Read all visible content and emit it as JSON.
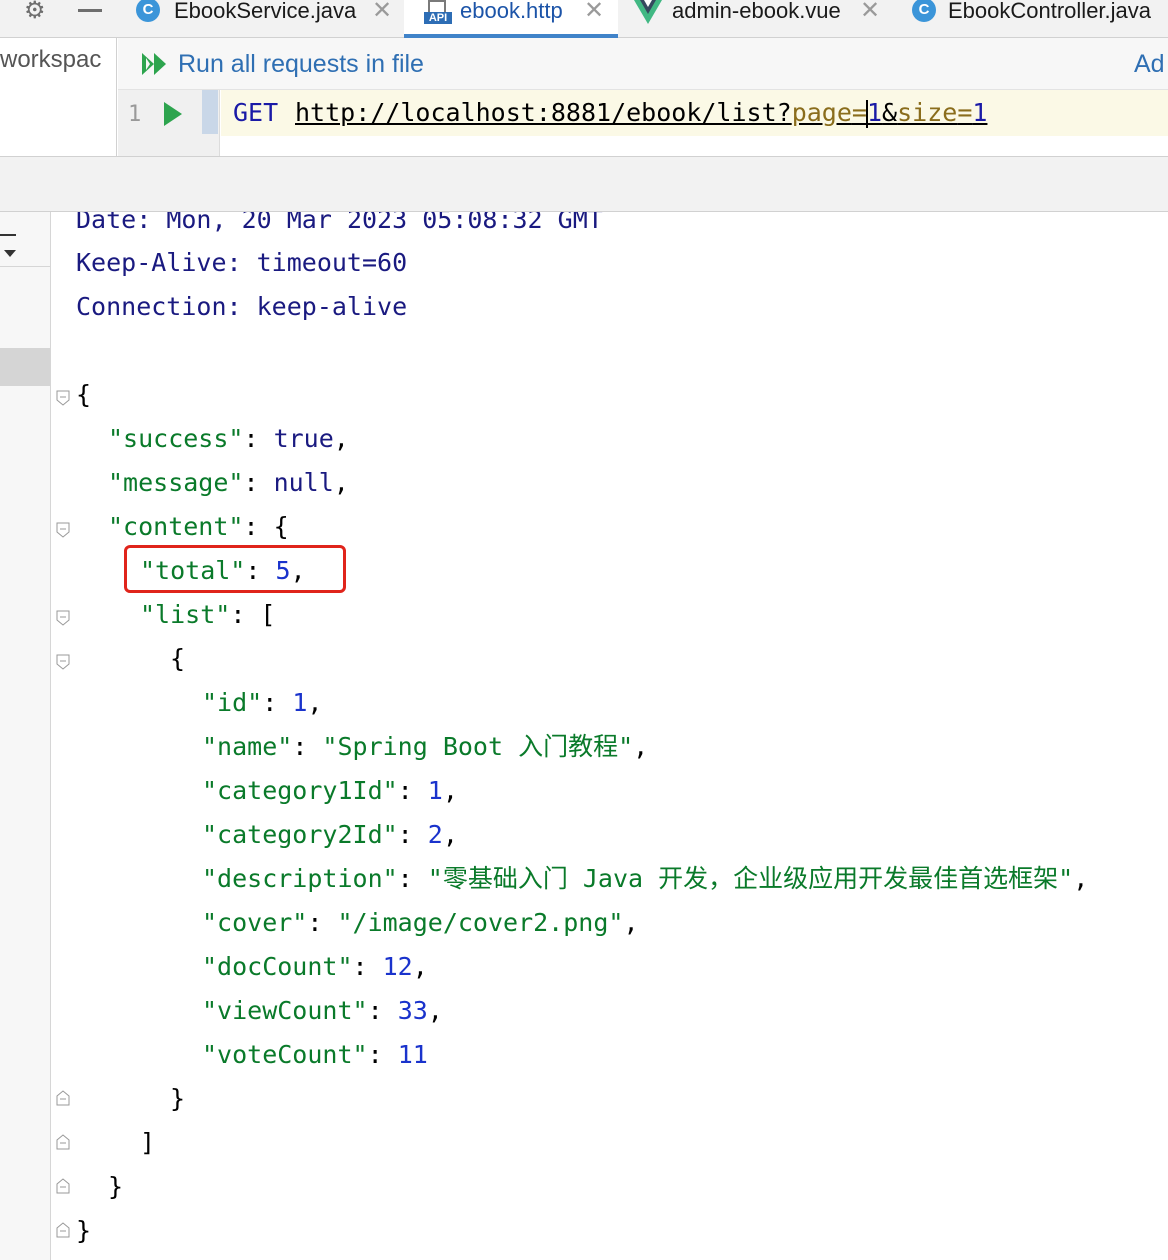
{
  "tabs": [
    {
      "label": "EbookService.java",
      "icon": "java-class-icon",
      "closable": true
    },
    {
      "label": "ebook.http",
      "icon": "api-file-icon",
      "closable": true,
      "active": true
    },
    {
      "label": "admin-ebook.vue",
      "icon": "vue-icon",
      "closable": true
    },
    {
      "label": "EbookController.java",
      "icon": "java-class-icon"
    }
  ],
  "sidebar": {
    "workspace_label": "workspac"
  },
  "runbar": {
    "run_all_label": "Run all requests in file",
    "add_label": "Ad"
  },
  "request": {
    "line_number": "1",
    "method": "GET",
    "url_base": "http://localhost:8881/ebook/list?",
    "param1_name": "page",
    "eq1": "=",
    "param1_value": "1",
    "amp": "&",
    "param2_name": "size",
    "eq2": "=",
    "param2_value": "1"
  },
  "response": {
    "headers": [
      {
        "name": "Date",
        "value": "Mon, 20 Mar 2023 05:08:32 GMT"
      },
      {
        "name": "Keep-Alive",
        "value": "timeout=60"
      },
      {
        "name": "Connection",
        "value": "keep-alive"
      }
    ],
    "json": {
      "success": "true",
      "message": "null",
      "total": "5",
      "item": {
        "id": "1",
        "name": "\"Spring Boot 入门教程\"",
        "category1Id": "1",
        "category2Id": "2",
        "description": "\"零基础入门 Java 开发，企业级应用开发最佳首选框架\"",
        "cover": "\"/image/cover2.png\"",
        "docCount": "12",
        "viewCount": "33",
        "voteCount": "11"
      }
    }
  },
  "colors": {
    "accent": "#4083c9",
    "highlight_box": "#e0241b",
    "json_key": "#0a7a2a",
    "json_number": "#1a33cc"
  }
}
